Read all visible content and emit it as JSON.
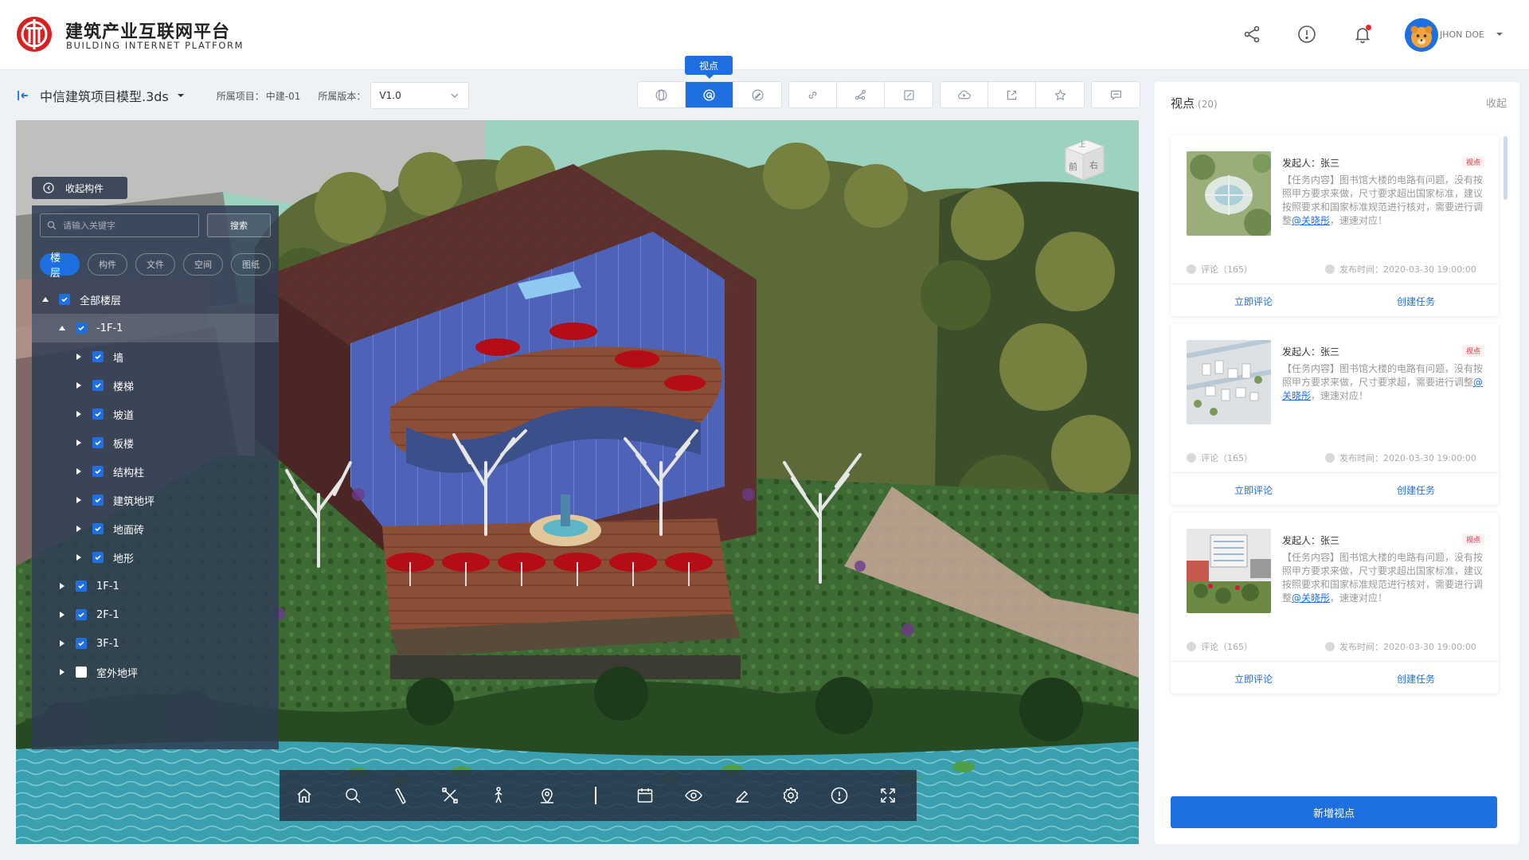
{
  "brand": {
    "name_cn": "建筑产业互联网平台",
    "name_en": "BUILDING INTERNET PLATFORM",
    "logo_icon": "citic-logo",
    "accent": "#1e6fe0",
    "logo_color": "#d7201f"
  },
  "header": {
    "icons": [
      "share-icon",
      "info-icon",
      "bell-icon"
    ],
    "user_name": "JHON DOE"
  },
  "file": {
    "name": "中信建筑项目模型.3ds",
    "project_label": "所属项目：",
    "project_value": "中建-01",
    "version_label": "所属版本：",
    "version_value": "V1.0"
  },
  "toolbar": {
    "tooltip": "视点",
    "groups": [
      [
        "orbit-icon",
        "viewpoint-icon",
        "edit-icon"
      ],
      [
        "link-icon",
        "share-nodes-icon",
        "markup-icon"
      ],
      [
        "cloud-upload-icon",
        "export-icon",
        "star-icon"
      ],
      [
        "comment-icon"
      ]
    ],
    "active": "viewpoint-icon"
  },
  "viewcube": {
    "top": "上",
    "front": "前",
    "right": "右"
  },
  "tree_panel": {
    "collapse_label": "收起构件",
    "search_placeholder": "请输入关键字",
    "search_button": "搜索",
    "tabs": [
      "楼层",
      "构件",
      "文件",
      "空间",
      "图纸"
    ],
    "active_tab": "楼层",
    "rows": [
      {
        "label": "全部楼层",
        "level": 0,
        "expanded": true,
        "checked": true
      },
      {
        "label": "-1F-1",
        "level": 1,
        "expanded": true,
        "checked": true,
        "selected": true
      },
      {
        "label": "墙",
        "level": 2,
        "expanded": false,
        "checked": true
      },
      {
        "label": "楼梯",
        "level": 2,
        "expanded": false,
        "checked": true
      },
      {
        "label": "坡道",
        "level": 2,
        "expanded": false,
        "checked": true
      },
      {
        "label": "板楼",
        "level": 2,
        "expanded": false,
        "checked": true
      },
      {
        "label": "结构柱",
        "level": 2,
        "expanded": false,
        "checked": true
      },
      {
        "label": "建筑地坪",
        "level": 2,
        "expanded": false,
        "checked": true
      },
      {
        "label": "地面砖",
        "level": 2,
        "expanded": false,
        "checked": true
      },
      {
        "label": "地形",
        "level": 2,
        "expanded": false,
        "checked": true
      },
      {
        "label": "1F-1",
        "level": 1,
        "expanded": false,
        "checked": true
      },
      {
        "label": "2F-1",
        "level": 1,
        "expanded": false,
        "checked": true
      },
      {
        "label": "3F-1",
        "level": 1,
        "expanded": false,
        "checked": true
      },
      {
        "label": "室外地坪",
        "level": 1,
        "expanded": false,
        "checked": false
      }
    ]
  },
  "bottom_toolbar": {
    "icons": [
      "home-icon",
      "zoom-icon",
      "measure-icon",
      "section-icon",
      "walk-icon",
      "location-icon",
      "calendar-icon",
      "view-icon",
      "annotate-icon",
      "settings-icon",
      "info-icon",
      "fullscreen-icon"
    ]
  },
  "side_panel": {
    "title": "视点",
    "count": "(20)",
    "collapse": "收起",
    "add_button": "新增视点",
    "cards": [
      {
        "thumb": "park-aerial",
        "author_label": "发起人：",
        "author": "张三",
        "badge": "视点",
        "desc_prefix": "【任务内容】图书馆大楼的电路有问题，没有按照甲方要求来做，尺寸要求超出国家标准，建议按照要求和国家标准规范进行核对，需要进行调整",
        "mention": "@关晓彤",
        "desc_suffix": "，速速对应！",
        "comments": "评论（165）",
        "time": "发布时间：2020-03-30  19:00:00",
        "action1": "立即评论",
        "action2": "创建任务"
      },
      {
        "thumb": "city-model",
        "author_label": "发起人：",
        "author": "张三",
        "badge": "视点",
        "desc_prefix": "【任务内容】图书馆大楼的电路有问题，没有按照甲方要求来做，尺寸要求超，需要进行调整",
        "mention": "@关晓彤",
        "desc_suffix": "，速速对应！",
        "comments": "评论（165）",
        "time": "发布时间：2020-03-30  19:00:00",
        "action1": "立即评论",
        "action2": "创建任务"
      },
      {
        "thumb": "building-model",
        "author_label": "发起人：",
        "author": "张三",
        "badge": "视点",
        "desc_prefix": "【任务内容】图书馆大楼的电路有问题，没有按照甲方要求来做，尺寸要求超出国家标准，建议按照要求和国家标准规范进行核对，需要进行调整",
        "mention": "@关晓彤",
        "desc_suffix": "，速速对应！",
        "comments": "评论（165）",
        "time": "发布时间：2020-03-30  19:00:00",
        "action1": "立即评论",
        "action2": "创建任务"
      }
    ]
  }
}
